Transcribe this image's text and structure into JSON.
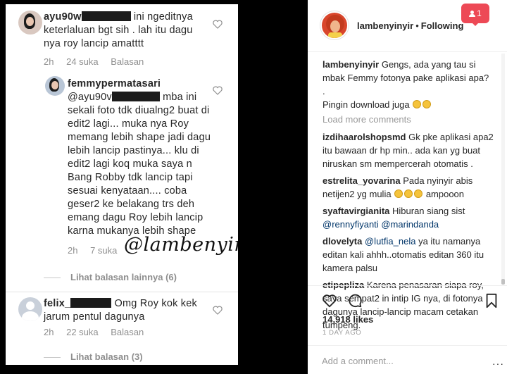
{
  "left": {
    "comments": [
      {
        "user": "ayu90w",
        "text": "ini nge­ditnya keterlaluan bgt sih . lah itu dagu nya  roy lancip amatttt",
        "time": "2h",
        "likes": "24 suka",
        "reply": "Balasan"
      },
      {
        "user": "femmypermatasari",
        "mention": "@ayu90v",
        "text": "mba ini sekali foto tdk diualng2 buat di edit2 lagi... muka nya Roy memang lebih shape  jadi dagu lebih lancip pastinya... klu di edit2 lagi koq muka saya n Bang Robby tdk lancip tapi sesuai kenyataan.... coba geser2 ke belakang trs deh emang dagu Roy lebih lancip karna mukanya lebih shape",
        "time": "2h",
        "likes": "7 suka"
      },
      {
        "user": "felix_",
        "text": "Omg Roy kok kek jarum pentul dagunya",
        "time": "2h",
        "likes": "22 suka",
        "reply": "Balasan"
      }
    ],
    "view_more_1": "Lihat balasan lainnya (6)",
    "view_more_2": "Lihat balasan (3)",
    "watermark": "@lambenyinyir"
  },
  "right": {
    "notification_count": "1",
    "username": "lambenyinyir",
    "follow_state": "Following",
    "caption_user": "lambenyinyir",
    "caption_1": "Gengs, ada yang tau si mbak Femmy fotonya pake aplikasi apa?",
    "caption_2": ".",
    "caption_3": "Pingin download juga",
    "load_more": "Load more comments",
    "comments": [
      {
        "user": "izdihaarolshopsmd",
        "text": "Gk pke aplikasi apa2 itu bawaan dr hp min.. ada kan yg buat niruskan sm mempercerah otomatis ."
      },
      {
        "user": "estrelita_yovarina",
        "text": "Pada nyinyir abis netijen2 yg mulia",
        "tail": "ampooon"
      },
      {
        "user": "syaftavirgianita",
        "text": "Hiburan siang sist",
        "tag1": "@rennyfiyanti",
        "tag2": "@marindanda"
      },
      {
        "user": "dlovelyta",
        "tag1": "@lutfia_nela",
        "text": "ya itu namanya editan kali ahhh..otomatis editan 360 itu kamera palsu"
      },
      {
        "user": "etipepliza",
        "text": "Karena penasaran siapa roy, saya sempat2 in intip IG nya, di fotonya dagunya lancip-lancip macam cetakan tumpeng."
      }
    ],
    "likes": "14,918 likes",
    "time": "1 DAY AGO",
    "add_comment_placeholder": "Add a comment...",
    "more_dots": "···"
  }
}
